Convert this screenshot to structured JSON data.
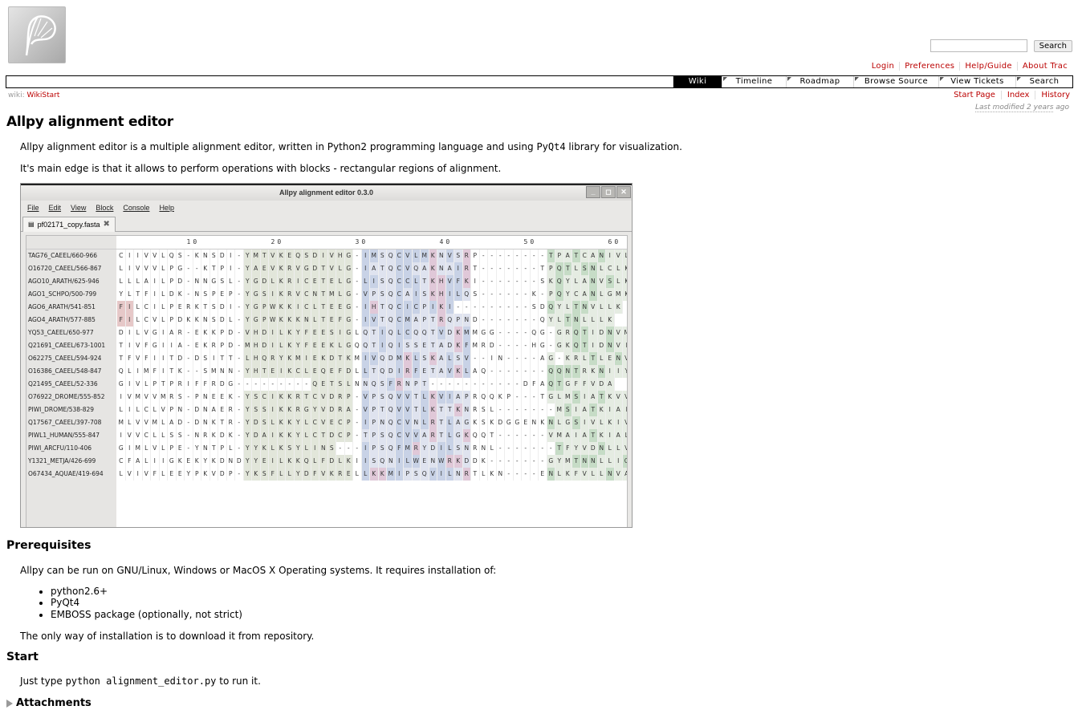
{
  "search": {
    "placeholder": "",
    "button": "Search"
  },
  "metanav": [
    "Login",
    "Preferences",
    "Help/Guide",
    "About Trac"
  ],
  "mainnav": [
    "Wiki",
    "Timeline",
    "Roadmap",
    "Browse Source",
    "View Tickets",
    "Search"
  ],
  "mainnav_active": "Wiki",
  "breadcrumb": {
    "prefix": "wiki:",
    "page": "WikiStart"
  },
  "ctxtnav": [
    "Start Page",
    "Index",
    "History"
  ],
  "lastmod": {
    "prefix": "Last modified",
    "age": "2 years",
    "suffix": "ago"
  },
  "content": {
    "title": "Allpy alignment editor",
    "intro_a": "Allpy alignment editor is a multiple alignment editor, written in Python2 programming language and using",
    "intro_code": "PyQt4",
    "intro_b": "library for visualization.",
    "edge": "It's main edge is that it allows to perform operations with blocks - rectangular regions of alignment.",
    "prereq_title": "Prerequisites",
    "prereq_text": "Allpy can be run on GNU/Linux, Windows or MacOS X Operating systems. It requires installation of:",
    "prereq_items": [
      "python2.6+",
      "PyQt4",
      "EMBOSS package (optionally, not strict)"
    ],
    "install_text": "The only way of installation is to download it from repository.",
    "start_title": "Start",
    "start_a": "Just type",
    "start_code": "python alignment_editor.py",
    "start_b": "to run it.",
    "attachments": "Attachments"
  },
  "app": {
    "title": "Allpy alignment editor 0.3.0",
    "menus": [
      "File",
      "Edit",
      "View",
      "Block",
      "Console",
      "Help"
    ],
    "tab": "pf02171_copy.fasta",
    "ruler": [
      "10",
      "20",
      "30",
      "40",
      "50",
      "60"
    ],
    "rows": [
      {
        "name": "TAG76_CAEEL/660-966",
        "seq": "CIIVVLQS-KNSDI-YMTVKEQSDIVHG-IMSQCVLMKNVSRP--------TPATCANIVLK"
      },
      {
        "name": "O16720_CAEEL/566-867",
        "seq": "LIVVVLPG--KTPI-YAEVKRVGDTVLG-IATQCVQAKNAIRT-------TPQTLSNLCLK"
      },
      {
        "name": "AGO10_ARATH/625-946",
        "seq": "LLLAILPD-NNGSL-YGDLKRICETELG-LISQCCLTKHVFKI-------SKQYLANVSLK"
      },
      {
        "name": "AGO1_SCHPO/500-799",
        "seq": "YLTFILDK-NSPEP-YGSIKRVCNTMLG-VPSQCAISKHILQS------K-PQYCANLGMK"
      },
      {
        "name": "AGO6_ARATH/541-851",
        "seq": "FILCILPERKTSDI-YGPWKKICLTEEG-IHTQCICPIKI---------SDQYLTNVLLK"
      },
      {
        "name": "AGO4_ARATH/577-885",
        "seq": "FILCVLPDKKNSDL-YGPWKKKNLTEFG-IVTQCMAPTRQPND-------QYLTNLLLK"
      },
      {
        "name": "YQ53_CAEEL/650-977",
        "seq": "DILVGIAR-EKKPD-VHDILKYFEESIGLQTIQLCQQTVDKMMGG----QG-GRQTIDNVMRK"
      },
      {
        "name": "Q21691_CAEEL/673-1001",
        "seq": "TIVFGIIA-EKRPD-MHDILKYFEEKLGQQTIQISSETADKFMRD----HG-GKQTIDNVIRK"
      },
      {
        "name": "O62275_CAEEL/594-924",
        "seq": "TFVFIITD-DSITT-LHQRYKMIEKDTKMIVQDMKLSKALSV--IN----AG-KRLTLENVINK"
      },
      {
        "name": "O16386_CAEEL/548-847",
        "seq": "QLIMFITK--SMNN-YHTEIKCLEQEFDLLTQDIRFETAVKLAQ-------QQNTRKNIIYK"
      },
      {
        "name": "Q21495_CAEEL/52-336",
        "seq": "GIVLPTPRIFFRDG---------QETSLNNQSFRNPT-----------DFAQTGFFVDA"
      },
      {
        "name": "O76922_DROME/555-852",
        "seq": "IVMVVMRS-PNEEK-YSCIKKRTCVDRP-VPSQVVTLKVIAPRQQKP---TGLMSIATKVVIQ"
      },
      {
        "name": "PIWI_DROME/538-829",
        "seq": "LILCLVPN-DNAER-YSSIKKRGYVDRA-VPTQVVTLKTTKNRSL-------MSIATKIAIQ"
      },
      {
        "name": "Q17567_CAEEL/397-708",
        "seq": "MLVVMLAD-DNKTR-YDSLKKYLCVECP-IPNQCVNLRTLAGKSKDGGENKNLGSIVLKIVLQ"
      },
      {
        "name": "PIWL1_HUMAN/555-847",
        "seq": "IVVCLLSS-NRKDK-YDAIKKYLCTDCP-TPSQCVVARTLGKQQT------VMAIATKIALQ"
      },
      {
        "name": "PIWI_ARCFU/110-406",
        "seq": "GIMLVLPE-YNTPL-YYKLKSYLINS---IPSQFMRYDILSNRNL-------TFYVDNLLVQ"
      },
      {
        "name": "Y1321_METJA/426-699",
        "seq": "CFALIIGKEKYKDNDYYEILKKQLFDLKIISQNILWENWRKDDK-------GYMTNNLLIQ"
      },
      {
        "name": "O67434_AQUAE/419-694",
        "seq": "LVIVFLEEYPKVDP-YKSFLLYDFVKRELLKKMIPSQVILNRTLKN----ENLKFVLLNVAEQ"
      }
    ]
  },
  "colors": {
    "link": "#bb0000",
    "nav_active_bg": "#000000",
    "hydrophobic": "#c8d2e6",
    "aromatic": "#c6dcc6",
    "charged_pos": "#e0c8d8",
    "special": "#e6c8c8"
  }
}
